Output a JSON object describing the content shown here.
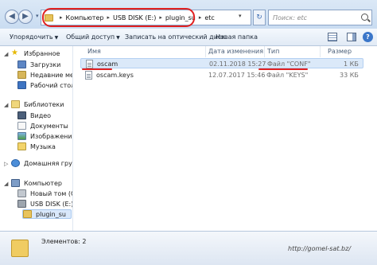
{
  "address_bar": {
    "breadcrumbs": [
      "Компьютер",
      "USB DISK (E:)",
      "plugin_su",
      "etc"
    ]
  },
  "search": {
    "placeholder": "Поиск: etc"
  },
  "toolbar": {
    "organize": "Упорядочить",
    "share": "Общий доступ",
    "burn": "Записать на оптический диск",
    "new_folder": "Новая папка"
  },
  "nav": {
    "favorites": "Избранное",
    "downloads": "Загрузки",
    "recent": "Недавние места",
    "desktop": "Рабочий стол",
    "libraries": "Библиотеки",
    "video": "Видео",
    "documents": "Документы",
    "images": "Изображения",
    "music": "Музыка",
    "homegroup": "Домашняя группа",
    "computer": "Компьютер",
    "new_volume": "Новый том (C:)",
    "usb_disk": "USB DISK (E:)",
    "plugin_su": "plugin_su"
  },
  "columns": {
    "name": "Имя",
    "date": "Дата изменения",
    "type": "Тип",
    "size": "Размер"
  },
  "files": [
    {
      "name": "oscam",
      "date": "02.11.2018 15:27",
      "type": "Файл \"CONF\"",
      "size": "1 КБ"
    },
    {
      "name": "oscam.keys",
      "date": "12.07.2017 15:46",
      "type": "Файл \"KEYS\"",
      "size": "33 КБ"
    }
  ],
  "status": {
    "items": "Элементов: 2"
  },
  "watermark": "http://gomel-sat.bz/",
  "colors": {
    "annotation_red": "#e02020",
    "selection_blue": "#dbe9f9"
  }
}
